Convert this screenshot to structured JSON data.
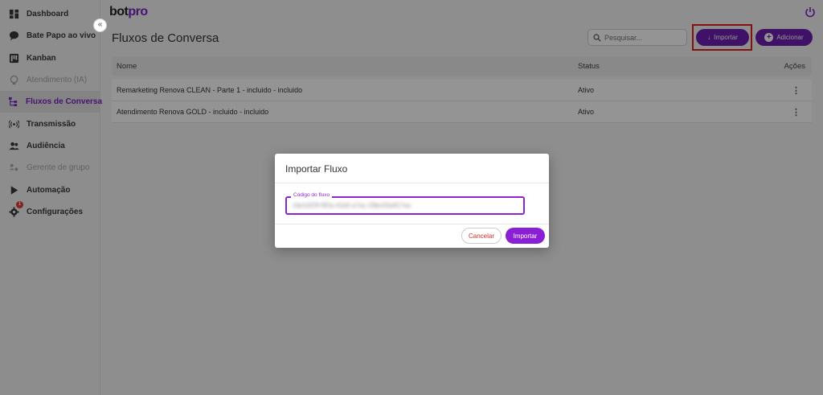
{
  "app": {
    "logo_main": "bot",
    "logo_accent": "pro"
  },
  "sidebar": {
    "collapse_icon": "double-chevron-left-icon",
    "items": [
      {
        "label": "Dashboard",
        "icon": "dashboard-icon",
        "state": "normal"
      },
      {
        "label": "Bate Papo ao vivo",
        "icon": "chat-bubble-icon",
        "state": "normal"
      },
      {
        "label": "Kanban",
        "icon": "kanban-icon",
        "state": "normal"
      },
      {
        "label": "Atendimento (IA)",
        "icon": "lightbulb-icon",
        "state": "disabled"
      },
      {
        "label": "Fluxos de Conversa",
        "icon": "flow-icon",
        "state": "active"
      },
      {
        "label": "Transmissão",
        "icon": "broadcast-icon",
        "state": "normal"
      },
      {
        "label": "Audiência",
        "icon": "people-icon",
        "state": "normal"
      },
      {
        "label": "Gerente de grupo",
        "icon": "group-manager-icon",
        "state": "disabled"
      },
      {
        "label": "Automação",
        "icon": "play-icon",
        "state": "normal"
      },
      {
        "label": "Configurações",
        "icon": "gear-icon",
        "state": "normal",
        "badge": "1"
      }
    ]
  },
  "header": {
    "title": "Fluxos de Conversa",
    "search_placeholder": "Pesquisar...",
    "import_label": "Importar",
    "add_label": "Adicionar"
  },
  "table": {
    "columns": {
      "name": "Nome",
      "status": "Status",
      "actions": "Ações"
    },
    "rows": [
      {
        "name": "Remarketing Renova CLEAN - Parte 1 - incluido - incluido",
        "status": "Ativo"
      },
      {
        "name": "Atendimento Renova GOLD - incluido - incluido",
        "status": "Ativo"
      }
    ]
  },
  "modal": {
    "title": "Importar Fluxo",
    "field_label": "Código do fluxo",
    "field_value": "c6e1d23f-9f2a-41b5-a7ac-29bc55e817ee",
    "cancel_label": "Cancelar",
    "confirm_label": "Importar"
  },
  "colors": {
    "accent": "#6d1fb3",
    "highlight": "#e02020",
    "cancel_text": "#d32f2f"
  }
}
